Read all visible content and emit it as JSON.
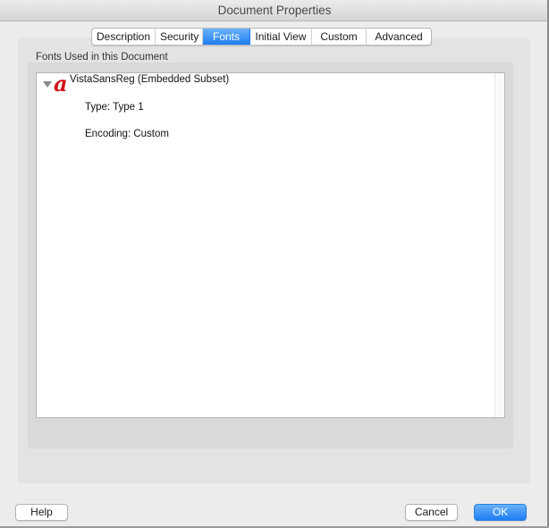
{
  "window": {
    "title": "Document Properties"
  },
  "tabs": [
    {
      "label": "Description",
      "active": false
    },
    {
      "label": "Security",
      "active": false
    },
    {
      "label": "Fonts",
      "active": true
    },
    {
      "label": "Initial View",
      "active": false
    },
    {
      "label": "Custom",
      "active": false
    },
    {
      "label": "Advanced",
      "active": false
    }
  ],
  "fonts_section": {
    "label": "Fonts Used in this Document",
    "fonts": [
      {
        "icon": "font-type1-icon",
        "icon_glyph": "a",
        "name": "VistaSansReg (Embedded Subset)",
        "expanded": true,
        "type": "Type: Type 1",
        "encoding": "Encoding: Custom"
      }
    ]
  },
  "buttons": {
    "help": "Help",
    "cancel": "Cancel",
    "ok": "OK"
  },
  "colors": {
    "accent": "#1d7cf2",
    "font_icon": "#d0121b"
  }
}
